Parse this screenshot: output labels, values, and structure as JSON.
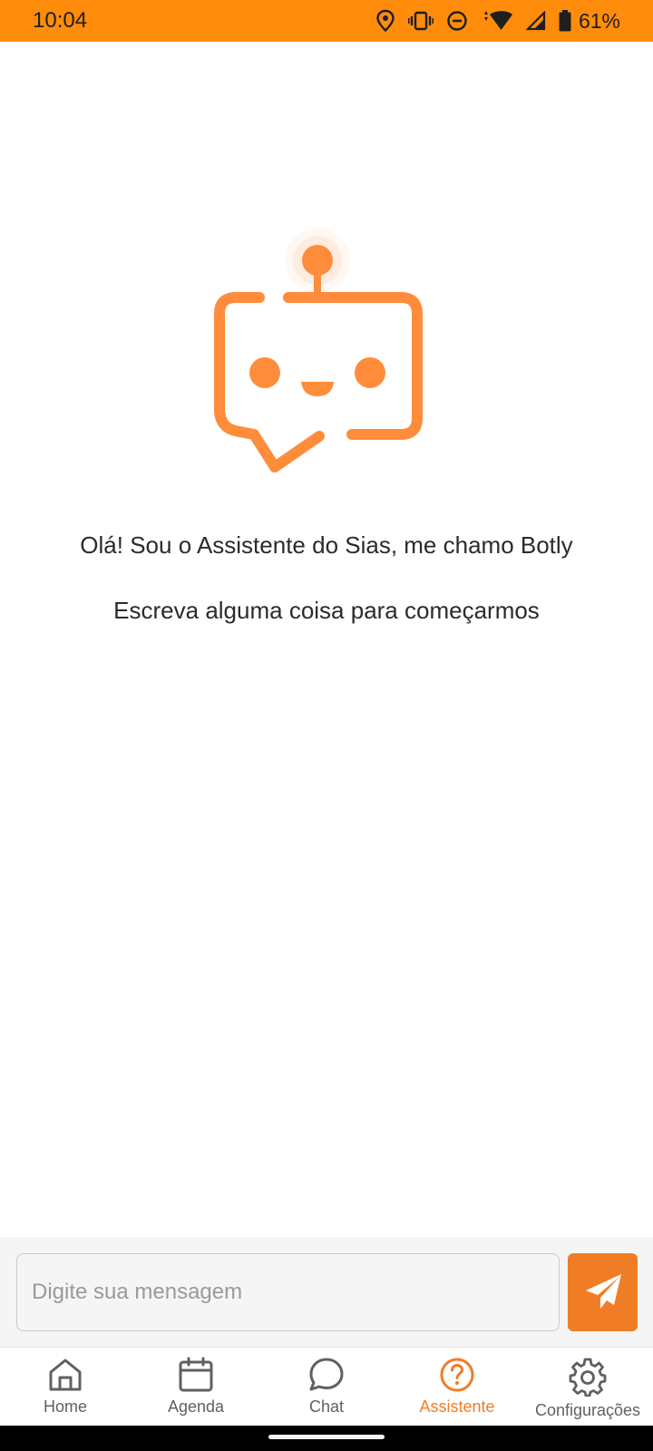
{
  "status_bar": {
    "time": "10:04",
    "battery": "61%",
    "icons": [
      "location-icon",
      "vibrate-icon",
      "do-not-disturb-icon",
      "wifi-icon",
      "signal-icon",
      "battery-icon"
    ],
    "background": "#ff8c0a"
  },
  "assistant": {
    "logo_icon": "robot-chat-bubble-icon",
    "greeting": "Olá! Sou o Assistente do Sias, me chamo Botly",
    "prompt": "Escreva alguma coisa para começarmos"
  },
  "composer": {
    "placeholder": "Digite sua mensagem",
    "value": "",
    "send_icon": "paper-plane-icon"
  },
  "nav": {
    "items": [
      {
        "label": "Home",
        "icon": "home-icon",
        "active": false
      },
      {
        "label": "Agenda",
        "icon": "calendar-icon",
        "active": false
      },
      {
        "label": "Chat",
        "icon": "chat-bubble-icon",
        "active": false
      },
      {
        "label": "Assistente",
        "icon": "help-circle-icon",
        "active": true
      },
      {
        "label": "Configurações",
        "icon": "gear-icon",
        "active": false
      }
    ]
  },
  "colors": {
    "accent": "#f07d26",
    "logo": "#ff8c3a",
    "text": "#2b2b2b",
    "muted": "#606060"
  }
}
